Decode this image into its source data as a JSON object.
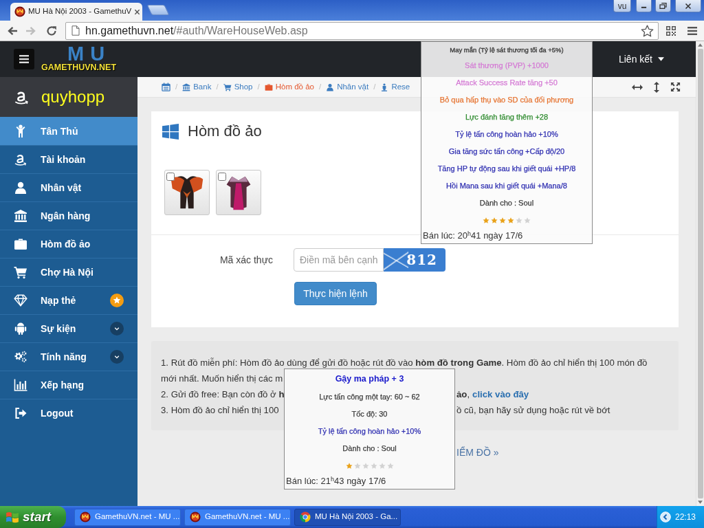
{
  "browser": {
    "tab_title": "MU Hà Nội 2003 - GamethuV",
    "profile": "vu",
    "forward_disabled": true,
    "url_host": "hn.gamethuvn.net",
    "url_path": "/#auth/WareHouseWeb.asp"
  },
  "navbar": {
    "logo_letters": "MU",
    "logo_text": "GAMETHUVN.NET",
    "links_menu": "Liên kết"
  },
  "sidebar": {
    "username": "quyhopp",
    "items": [
      {
        "label": "Tân Thủ",
        "selected": true,
        "kind": "plain"
      },
      {
        "label": "Tài khoản",
        "selected": false,
        "kind": "plain"
      },
      {
        "label": "Nhân vật",
        "selected": false,
        "kind": "plain"
      },
      {
        "label": "Ngân hàng",
        "selected": false,
        "kind": "plain"
      },
      {
        "label": "Hòm đồ ảo",
        "selected": false,
        "kind": "plain"
      },
      {
        "label": "Chợ Hà Nội",
        "selected": false,
        "kind": "plain"
      },
      {
        "label": "Nạp thẻ",
        "selected": false,
        "kind": "badge"
      },
      {
        "label": "Sự kiện",
        "selected": false,
        "kind": "submenu",
        "expanded": false
      },
      {
        "label": "Tính năng",
        "selected": false,
        "kind": "submenu",
        "expanded": false
      },
      {
        "label": "Xếp hạng",
        "selected": false,
        "kind": "plain"
      },
      {
        "label": "Logout",
        "selected": false,
        "kind": "plain"
      }
    ]
  },
  "breadcrumb": {
    "items": [
      {
        "selected": false,
        "separator": "/"
      },
      {
        "label": "Bank",
        "selected": false,
        "separator": "/"
      },
      {
        "label": "Shop",
        "selected": false,
        "separator": "/"
      },
      {
        "label": "Hòm đồ ảo",
        "selected": true,
        "separator": "/"
      },
      {
        "label": "Nhân vật",
        "selected": false,
        "separator": "/"
      },
      {
        "label": "Rese",
        "selected": false
      }
    ]
  },
  "panel": {
    "title": "Hòm đồ ảo",
    "items": [
      {
        "checked": false
      },
      {
        "checked": false
      }
    ],
    "captcha_label": "Mã xác thực",
    "captcha_placeholder": "Điền mã bên cạnh",
    "captcha_code": "812",
    "submit": "Thực hiện lệnh"
  },
  "info_lines": [
    {
      "left": "1. Rút đồ miễn phí: Hòm đồ ảo dùng để gửi đồ hoặc rút đồ vào **hòm đồ trong Game**. Hòm đồ ảo chỉ hiển thị 100 món đồ"
    },
    {
      "left": "mới nhất. Muốn hiển thị các m"
    },
    {
      "left": "2. Gửi đồ free: Bạn còn đồ ở **h**",
      "right": "**ảo**,",
      "link": "click vào đây"
    },
    {
      "left": "3. Hòm đồ ảo chỉ hiển thị 100",
      "right": "ồ cũ, bạn hãy sử dụng hoặc rút về bớt"
    }
  ],
  "footer_link": "IỂM ĐỒ »",
  "tooltips": [
    {
      "lines": [
        {
          "text": "May mắn (Tỷ lệ sát thương tối đa +5%)",
          "color": "#3a3a3a",
          "kind": "minor"
        },
        {
          "text": "Sát thương (PVP) +1000",
          "color": "#d479d4",
          "kind": "normal"
        },
        {
          "text": "Attack Success Rate tăng +50",
          "color": "#d479d4",
          "kind": "normal"
        },
        {
          "text": "Bỏ qua hấp thụ vào SD của đối phương",
          "color": "#e67330",
          "kind": "normal"
        },
        {
          "text": "Lực đánh tăng thêm +28",
          "color": "#2d8a2d",
          "kind": "normal"
        },
        {
          "text": "Tỷ lệ tấn công hoàn hảo +10%",
          "color": "#2c2cb0",
          "kind": "normal"
        },
        {
          "text": "Gia tăng sức tấn công +Cấp độ/20",
          "color": "#2c2cb0",
          "kind": "normal"
        },
        {
          "text": "Tăng HP tự động sau khi giết quái +HP/8",
          "color": "#2c2cb0",
          "kind": "normal"
        },
        {
          "text": "Hồi Mana sau khi giết quái +Mana/8",
          "color": "#2c2cb0",
          "kind": "normal"
        },
        {
          "text": "Dành cho : Soul",
          "color": "#3a3a3a",
          "kind": "normal"
        }
      ],
      "stars": 4,
      "sold_at": "Bán lúc: 20$^{h}$41 ngày 17/6"
    },
    {
      "title": "Gậy ma pháp + 3",
      "lines": [
        {
          "text": "Lực tấn công một tay: 60 ~ 62",
          "color": "#3a3a3a",
          "kind": "normal"
        },
        {
          "text": "Tốc độ: 30",
          "color": "#3a3a3a",
          "kind": "normal"
        },
        {
          "text": "Tỷ lệ tấn công hoàn hảo +10%",
          "color": "#2c2cb0",
          "kind": "normal"
        },
        {
          "text": "Dành cho : Soul",
          "color": "#3a3a3a",
          "kind": "normal"
        }
      ],
      "stars": 1,
      "sold_at": "Bán lúc: 21$^{h}$43 ngày 17/6"
    }
  ],
  "taskbar": {
    "start": "start",
    "tasks": [
      {
        "label": "GamethuVN.net - MU ...",
        "selected": false
      },
      {
        "label": "GamethuVN.net - MU ...",
        "selected": false
      },
      {
        "label": "MU Hà Nội 2003 - Ga...",
        "selected": true
      }
    ],
    "clock": "22:13"
  }
}
